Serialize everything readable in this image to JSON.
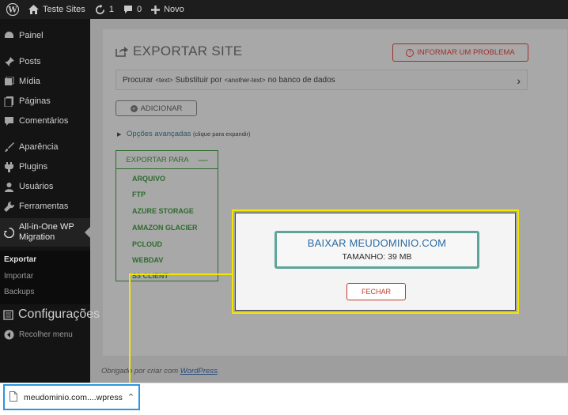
{
  "adminbar": {
    "site_name": "Teste Sites",
    "updates_count": "1",
    "comments_count": "0",
    "new_label": "Novo"
  },
  "sidebar": {
    "items": [
      {
        "label": "Painel",
        "icon": "dashboard-icon"
      },
      {
        "label": "Posts",
        "icon": "pin-icon"
      },
      {
        "label": "Mídia",
        "icon": "media-icon"
      },
      {
        "label": "Páginas",
        "icon": "pages-icon"
      },
      {
        "label": "Comentários",
        "icon": "comments-icon"
      },
      {
        "label": "Aparência",
        "icon": "brush-icon"
      },
      {
        "label": "Plugins",
        "icon": "plugin-icon"
      },
      {
        "label": "Usuários",
        "icon": "users-icon"
      },
      {
        "label": "Ferramentas",
        "icon": "wrench-icon"
      },
      {
        "label": "All-in-One WP Migration",
        "label_line1": "All-in-One WP",
        "label_line2": "Migration",
        "icon": "migration-icon"
      },
      {
        "label": "Configurações",
        "icon": "settings-icon"
      },
      {
        "label": "Recolher menu",
        "icon": "collapse-icon"
      }
    ],
    "submenu": [
      "Exportar",
      "Importar",
      "Backups"
    ]
  },
  "main": {
    "title": "EXPORTAR SITE",
    "report_button": "INFORMAR UM PROBLEMA",
    "find_replace": {
      "procurar": "Procurar",
      "text_tag": "<text>",
      "substituir": "Substituir por",
      "another_tag": "<another-text>",
      "suffix": "no banco de dados"
    },
    "add_button": "ADICIONAR",
    "advanced_label": "Opções avançadas",
    "advanced_hint": "(clique para expandir)",
    "export_to": {
      "header": "EXPORTAR PARA",
      "options": [
        "ARQUIVO",
        "FTP",
        "AZURE STORAGE",
        "AMAZON GLACIER",
        "PCLOUD",
        "WEBDAV",
        "S3 CLIENT"
      ]
    },
    "footer_thanks": "Obrigado por criar com",
    "footer_link": "WordPress",
    "footer_end": "."
  },
  "modal": {
    "download_title": "BAIXAR MEUDOMINIO.COM",
    "size_label": "TAMANHO: 39 MB",
    "close_button": "FECHAR"
  },
  "download_bar": {
    "filename": "meudominio.com....wpress"
  },
  "colors": {
    "highlight": "#f2e600",
    "download_focus": "#2d96e0",
    "export_green": "#2e6b2e",
    "danger": "#c0392b"
  }
}
